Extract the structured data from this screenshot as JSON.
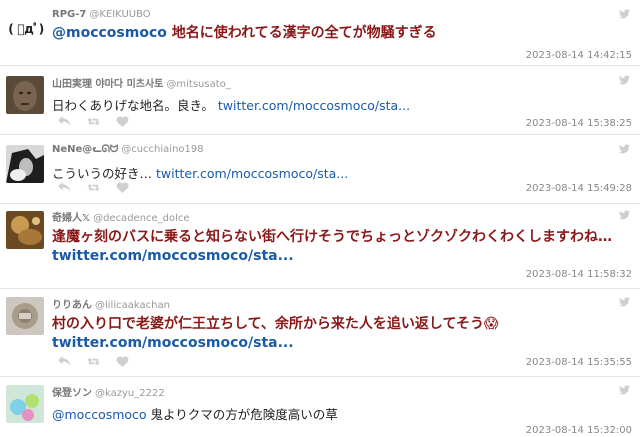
{
  "tweets": [
    {
      "avatar_text": "( ﾟдﾟ)",
      "display_name": "RPG-7",
      "username": "@KEIKUUBO",
      "mention": "@moccosmoco",
      "text": " 地名に使われてる漢字の全てが物騒すぎる",
      "link": "",
      "time": "2023-08-14 14:42:15"
    },
    {
      "display_name": "山田実理 야마다 미츠사토",
      "username": "@mitsusato_",
      "mention": "",
      "text": "日わくありげな地名。良き。 ",
      "link": "twitter.com/moccosmoco/sta...",
      "time": "2023-08-14 15:38:25"
    },
    {
      "display_name": "NeNe@ᓚᘏᗢ",
      "username": "@cucchiaino198",
      "mention": "",
      "text": "こういうの好き… ",
      "link": "twitter.com/moccosmoco/sta...",
      "time": "2023-08-14 15:49:28"
    },
    {
      "display_name": "奇婦人𝕏",
      "username": "@decadence_dolce",
      "mention": "",
      "text": "逢魔ヶ刻のバスに乗ると知らない街へ行けそうでちょっとゾクゾクわくわくしますわね…",
      "link": "twitter.com/moccosmoco/sta...",
      "time": "2023-08-14 11:58:32"
    },
    {
      "display_name": "りりあん",
      "username": "@lilicaakachan",
      "mention": "",
      "text": "村の入り口で老婆が仁王立ちして、余所から来た人を追い返してそう😱",
      "link": "twitter.com/moccosmoco/sta...",
      "time": "2023-08-14 15:35:55"
    },
    {
      "display_name": "保登ソン",
      "username": "@kazyu_2222",
      "mention": "@moccosmoco",
      "text": " 鬼よりクマの方が危険度高いの草",
      "link": "",
      "time": "2023-08-14 15:32:00"
    }
  ],
  "icons": {
    "reply": "reply-icon",
    "retweet": "retweet-icon",
    "like": "heart-icon",
    "brand": "twitter-bird-icon"
  },
  "colors": {
    "highlight_text": "#8b1818",
    "link": "#1a5aa8",
    "meta": "#999999"
  }
}
